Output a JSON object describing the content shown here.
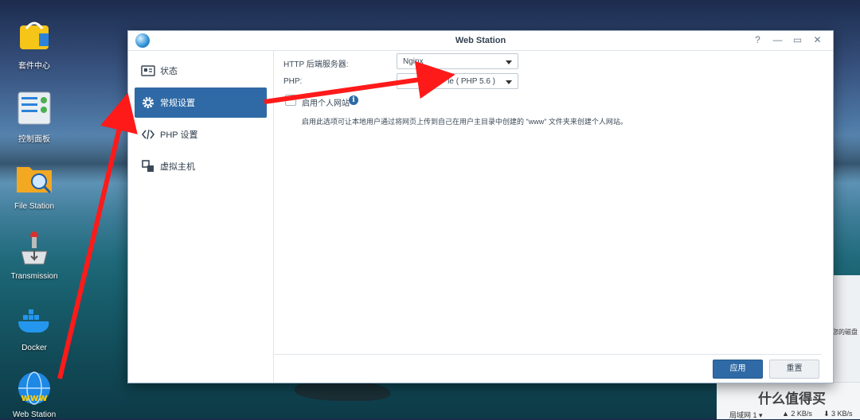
{
  "desktop": {
    "icons": [
      {
        "label": "套件中心",
        "icon": "package-center-icon"
      },
      {
        "label": "控制面板",
        "icon": "control-panel-icon"
      },
      {
        "label": "File Station",
        "icon": "file-station-icon"
      },
      {
        "label": "Transmission",
        "icon": "transmission-icon"
      },
      {
        "label": "Docker",
        "icon": "docker-icon"
      },
      {
        "label": "Web Station",
        "icon": "web-station-icon"
      }
    ]
  },
  "window": {
    "title": "Web Station",
    "controls": {
      "help": "?",
      "minimize": "—",
      "maximize": "▭",
      "close": "✕"
    }
  },
  "sidebar": {
    "items": [
      {
        "label": "状态",
        "icon": "status-icon"
      },
      {
        "label": "常规设置",
        "icon": "gear-icon",
        "active": true
      },
      {
        "label": "PHP 设置",
        "icon": "code-icon"
      },
      {
        "label": "虚拟主机",
        "icon": "virtual-host-icon"
      }
    ]
  },
  "settings": {
    "http_label": "HTTP 后端服务器:",
    "http_value": "Nginx",
    "php_label": "PHP:",
    "php_value": "le ( PHP 5.6 )",
    "personal_site_label": "启用个人网站",
    "personal_site_checked": false,
    "description": "启用此选项可让本地用户通过将网页上传到自己在用户主目录中创建的 \"www\" 文件夹来创建个人网站。"
  },
  "buttons": {
    "apply": "应用",
    "reset": "重置"
  },
  "background_fragments": {
    "right_panel_text": "您的磁盘",
    "net_label": "局域网 1 ▾",
    "upload_speed": "▲ 2 KB/s",
    "download_speed": "⬇ 3 KB/s",
    "watermark": "什么值得买"
  },
  "colors": {
    "accent": "#2f6aa6",
    "arrow": "#ff1a1a"
  }
}
